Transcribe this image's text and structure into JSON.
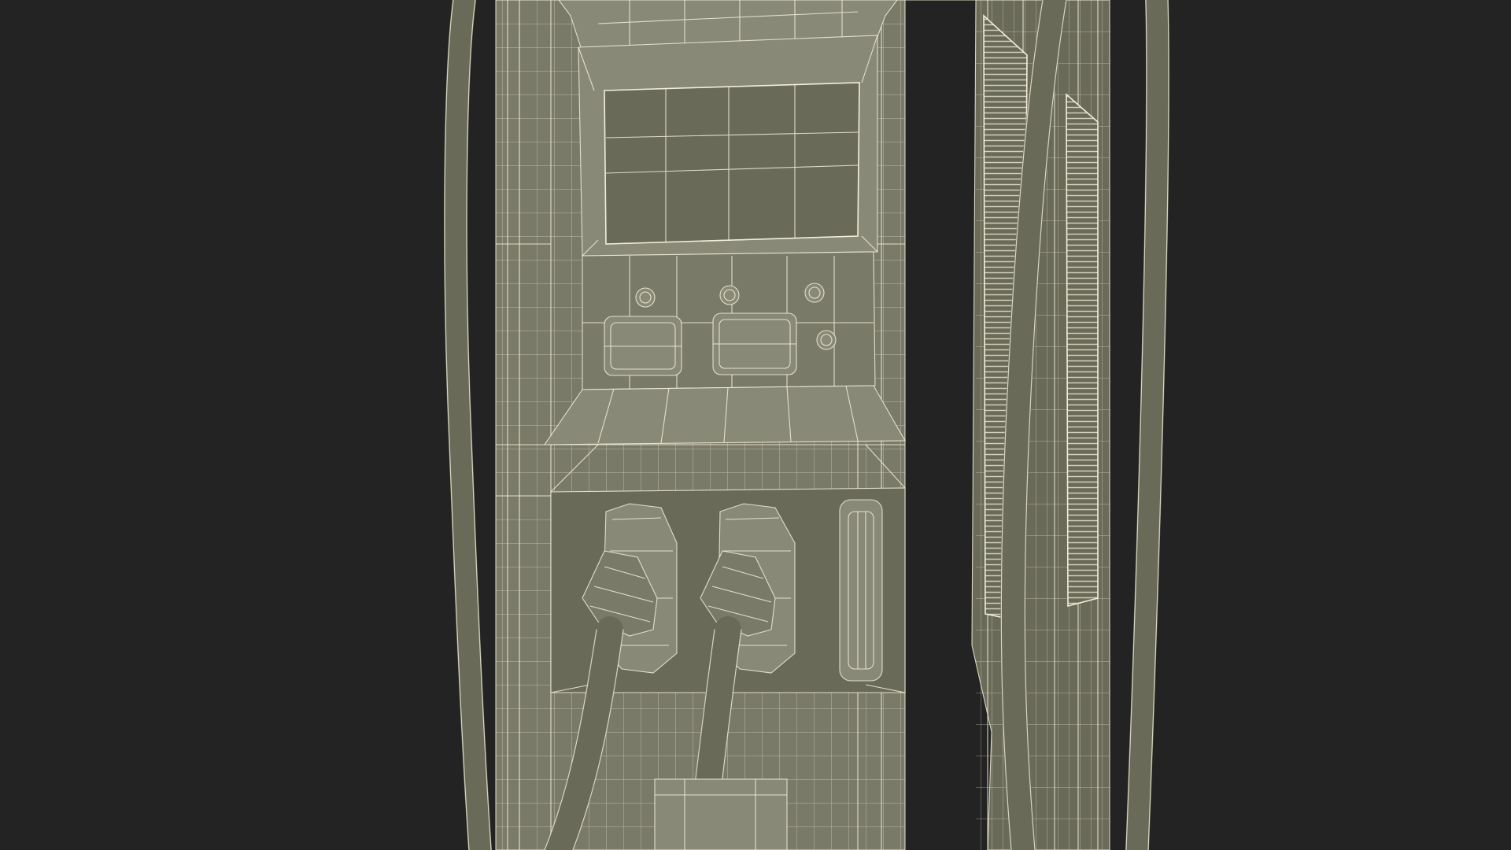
{
  "scene": {
    "background_color": "#232323",
    "surface_color": "#7a7a68",
    "surface_dark_color": "#6a6a59",
    "surface_light_color": "#898977",
    "wire_color": "#f3efdc"
  },
  "icons": {
    "buttons": [
      "button-bolt-icon",
      "button-bolt-icon",
      "button-bolt-icon",
      "button-bolt-icon"
    ],
    "connectors": [
      "charging-connector-icon",
      "charging-connector-icon"
    ]
  }
}
